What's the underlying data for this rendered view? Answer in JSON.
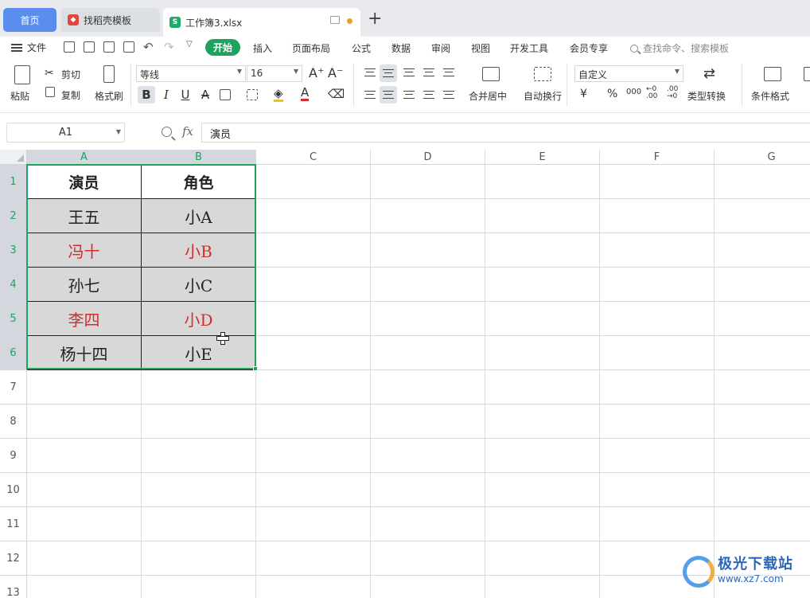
{
  "tabs": {
    "home": "首页",
    "template": "找稻壳模板",
    "workbook": "工作簿3.xlsx",
    "add": "+"
  },
  "menu": {
    "file": "文件",
    "start": "开始",
    "items": [
      "插入",
      "页面布局",
      "公式",
      "数据",
      "审阅",
      "视图",
      "开发工具",
      "会员专享"
    ],
    "search_placeholder": "查找命令、搜索模板"
  },
  "ribbon": {
    "paste": "粘贴",
    "cut": "剪切",
    "copy": "复制",
    "format_painter": "格式刷",
    "font_name": "等线",
    "font_size": "16",
    "bold": "B",
    "italic": "I",
    "underline": "U",
    "strike": "A",
    "merge_center": "合并居中",
    "wrap_text": "自动换行",
    "number_format": "自定义",
    "currency": "¥",
    "percent": "%",
    "thousands": "000",
    "type_convert": "类型转换",
    "conditional_format": "条件格式"
  },
  "formula_bar": {
    "cell_ref": "A1",
    "fx": "fx",
    "content": "演员"
  },
  "sheet": {
    "columns": [
      "A",
      "B",
      "C",
      "D",
      "E",
      "F",
      "G"
    ],
    "rows": [
      "1",
      "2",
      "3",
      "4",
      "5",
      "6",
      "7",
      "8",
      "9",
      "10",
      "11",
      "12",
      "13"
    ],
    "header": [
      "演员",
      "角色"
    ],
    "data": [
      [
        "王五",
        "小A"
      ],
      [
        "冯十",
        "小B"
      ],
      [
        "孙七",
        "小C"
      ],
      [
        "李四",
        "小D"
      ],
      [
        "杨十四",
        "小E"
      ]
    ],
    "red_rows": [
      1,
      3
    ],
    "red_color": "#d42b2b",
    "selection_color": "#1ea35f"
  },
  "watermark": {
    "name": "极光下载站",
    "url": "www.xz7.com"
  }
}
